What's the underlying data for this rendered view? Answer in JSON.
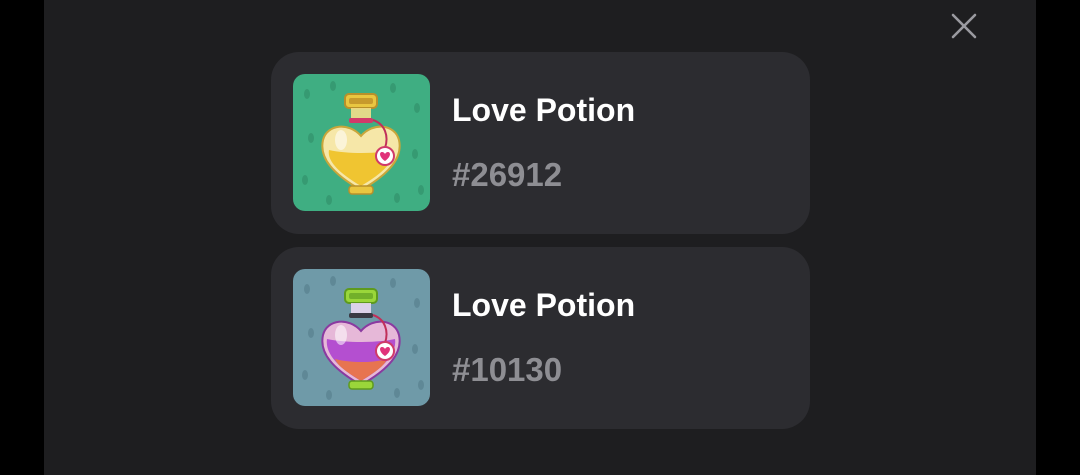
{
  "modal": {
    "close_icon": "close-icon"
  },
  "items": [
    {
      "name": "Love Potion",
      "id": "#26912",
      "icon": "yellow-heart-potion-icon",
      "bg_color": "#3fae82",
      "liquid_color": "#f0c531"
    },
    {
      "name": "Love Potion",
      "id": "#10130",
      "icon": "purple-heart-potion-icon",
      "bg_color": "#6f9aa8",
      "liquid_color": "#b44fd0"
    }
  ]
}
